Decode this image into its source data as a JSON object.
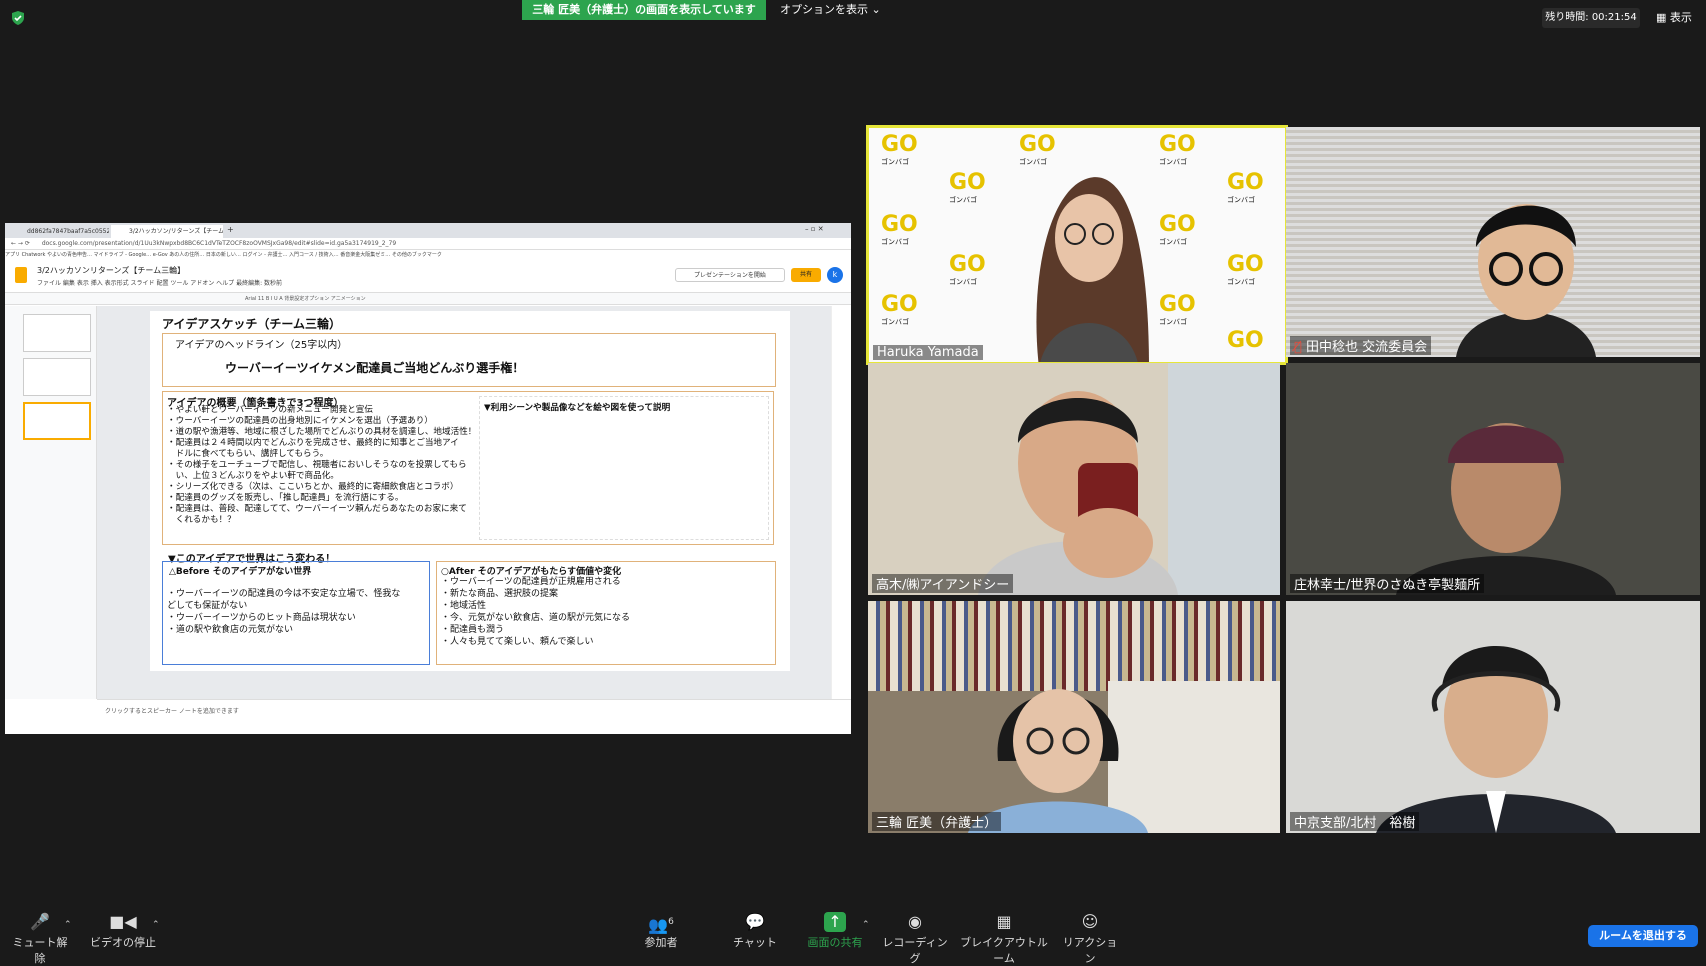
{
  "top": {
    "banner": "三輪 匠美（弁護士）の画面を表示しています",
    "options": "オプションを表示 ⌄",
    "timer": "残り時間: 00:21:54",
    "view": "表示"
  },
  "shared": {
    "tabs": [
      "dd862fa7847baaf7a5c0552186...",
      "3/2ハッカソン/リターンズ【チーム三輪】"
    ],
    "url": "docs.google.com/presentation/d/1Uu3kNwpxbd8BC6C1dVTeTZOCF8zoOVMSJxGa98/edit#slide=id.ga5a3174919_2_79",
    "bookmarks": "アプリ  Chatwork  やよいの青色申告…  マイドライブ - Google…  e-Gov  あの人の住所…  日本の新しい…  ログイン - 弁護士…  入門コース / 技術入…  番音楽金大阪集ゼミ…  その他のブックマーク",
    "doc_title": "3/2ハッカソンリターンズ【チーム三輪】",
    "menu": "ファイル  編集  表示  挿入  表示形式  スライド  配置  ツール  アドオン  ヘルプ  最終編集: 数秒前",
    "present": "プレゼンテーションを開始",
    "share": "共有",
    "avatar": "k",
    "toolbar": "Arial  11  B  I  U  A   背景設定オプション   アニメーション",
    "notes": "クリックするとスピーカー ノートを追加できます",
    "slide": {
      "title": "アイデアスケッチ（チーム三輪）",
      "headline_label": "アイデアのヘッドライン（25字以内）",
      "headline": "ウーバーイーツイケメン配達員ご当地どんぶり選手権！",
      "summary_label": "アイデアの概要（箇条書きで3つ程度）",
      "summary": [
        "・やよい軒とウーバーイーツの新メニュー開発と宣伝",
        "・ウーバーイーツの配達員の出身地別にイケメンを選出（予選あり）",
        "・道の駅や漁港等、地域に根ざした場所でどんぶりの具材を調達し、地域活性！",
        "・配達員は２４時間以内でどんぶりを完成させ、最終的に知事とご当地アイ",
        "　ドルに食べてもらい、講評してもらう。",
        "・その様子をユーチューブで配信し、視聴者においしそうなのを投票してもら",
        "　い、上位３どんぶりをやよい軒で商品化。",
        "・シリーズ化できる（次は、ここいちとか、最終的に寄細飲食店とコラボ）",
        "・配達員のグッズを販売し、「推し配達員」を流行語にする。",
        "・配達員は、普段、配達してて、ウーバーイーツ頼んだらあなたのお家に来て",
        "　くれるかも！？"
      ],
      "usage_label": "▼利用シーンや製品像などを絵や図を使って説明",
      "change_label": "▼このアイデアで世界はこう変わる！",
      "before_label": "△Before そのアイデアがない世界",
      "before": [
        "・ウーバーイーツの配達員の今は不安定な立場で、怪我な",
        "どしても保証がない",
        "・ウーバーイーツからのヒット商品は現状ない",
        "・道の駅や飲食店の元気がない"
      ],
      "after_label": "○After そのアイデアがもたらす価値や変化",
      "after": [
        "・ウーバーイーツの配達員が正規雇用される",
        "・新たな商品、選択肢の提案",
        "・地域活性",
        "・今、元気がない飲食店、道の駅が元気になる",
        "・配達員も潤う",
        "・人々も見てて楽しい、頼んで楽しい"
      ]
    }
  },
  "participants": [
    {
      "name": "Haruka Yamada"
    },
    {
      "name": "田中稔也 交流委員会"
    },
    {
      "name": "高木/㈱アイアンドシー"
    },
    {
      "name": "庄林幸士/世界のさぬき亭製麺所"
    },
    {
      "name": "三輪 匠美（弁護士）"
    },
    {
      "name": "中京支部/北村　裕樹"
    }
  ],
  "go_logo": {
    "letters": "GO",
    "sub": "ゴンバゴ"
  },
  "toolbar": {
    "mute": "ミュート解除",
    "video": "ビデオの停止",
    "participants": "参加者",
    "participants_count": "6",
    "chat": "チャット",
    "share": "画面の共有",
    "record": "レコーディング",
    "breakout": "ブレイクアウトルーム",
    "reaction": "リアクション",
    "leave": "ルームを退出する"
  },
  "colors": {
    "share_green": "#2da44e",
    "active_speaker": "#e6e639",
    "leave_blue": "#1a73e8"
  }
}
